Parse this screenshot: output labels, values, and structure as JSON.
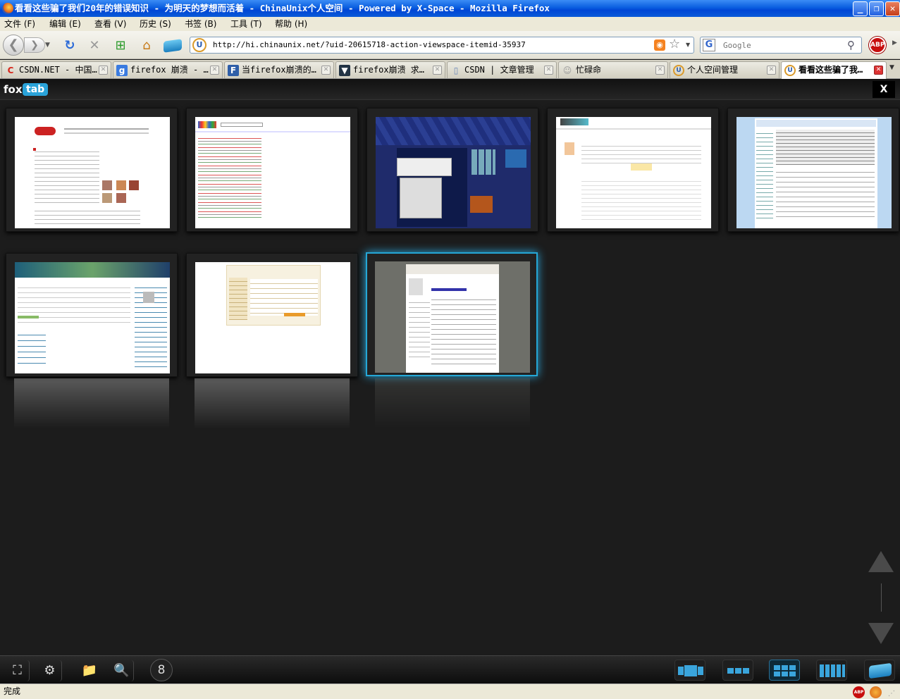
{
  "window": {
    "title": "看看这些骗了我们20年的错误知识 - 为明天的梦想而活着 - ChinaUnix个人空间 - Powered by X-Space - Mozilla Firefox",
    "minimize_icon": "minimize-icon",
    "maximize_icon": "restore-icon",
    "close_icon": "close-icon"
  },
  "menu": {
    "file": "文件 (F)",
    "edit": "编辑 (E)",
    "view": "查看 (V)",
    "history": "历史 (S)",
    "bookmarks": "书签 (B)",
    "tools": "工具 (T)",
    "help": "帮助 (H)"
  },
  "toolbar": {
    "url": "http://hi.chinaunix.net/?uid-20615718-action-viewspace-itemid-35937",
    "search_placeholder": "Google",
    "search_engine_letter": "G",
    "abp_label": "ABP",
    "identity_letter": "U"
  },
  "tabs": [
    {
      "label": "CSDN.NET - 中国…",
      "favicon": "csdn-icon",
      "fav_char": "C",
      "fav_color": "#d7261b"
    },
    {
      "label": "firefox 崩溃 - …",
      "favicon": "google-icon",
      "fav_char": "g",
      "fav_color": "#3a7be0"
    },
    {
      "label": "当firefox崩溃的…",
      "favicon": "page-icon",
      "fav_char": "F",
      "fav_color": "#2e5ea8"
    },
    {
      "label": "firefox崩溃 求…",
      "favicon": "shield-icon",
      "fav_char": "▼",
      "fav_color": "#234"
    },
    {
      "label": "CSDN | 文章管理",
      "favicon": "document-icon",
      "fav_char": "▯",
      "fav_color": "#6b87b8"
    },
    {
      "label": "忙碌命",
      "favicon": "user-icon",
      "fav_char": "☺",
      "fav_color": "#999"
    },
    {
      "label": "个人空间管理",
      "favicon": "chinaunix-icon",
      "fav_char": "U",
      "fav_color": "#d99a2b"
    },
    {
      "label": "看看这些骗了我…",
      "favicon": "chinaunix-icon",
      "fav_char": "U",
      "fav_color": "#d99a2b"
    }
  ],
  "foxtab": {
    "logo_text": "fox",
    "logo_badge": "tab",
    "close_label": "X",
    "tab_count": "8",
    "selected_index": 7
  },
  "status": {
    "text": "完成"
  }
}
